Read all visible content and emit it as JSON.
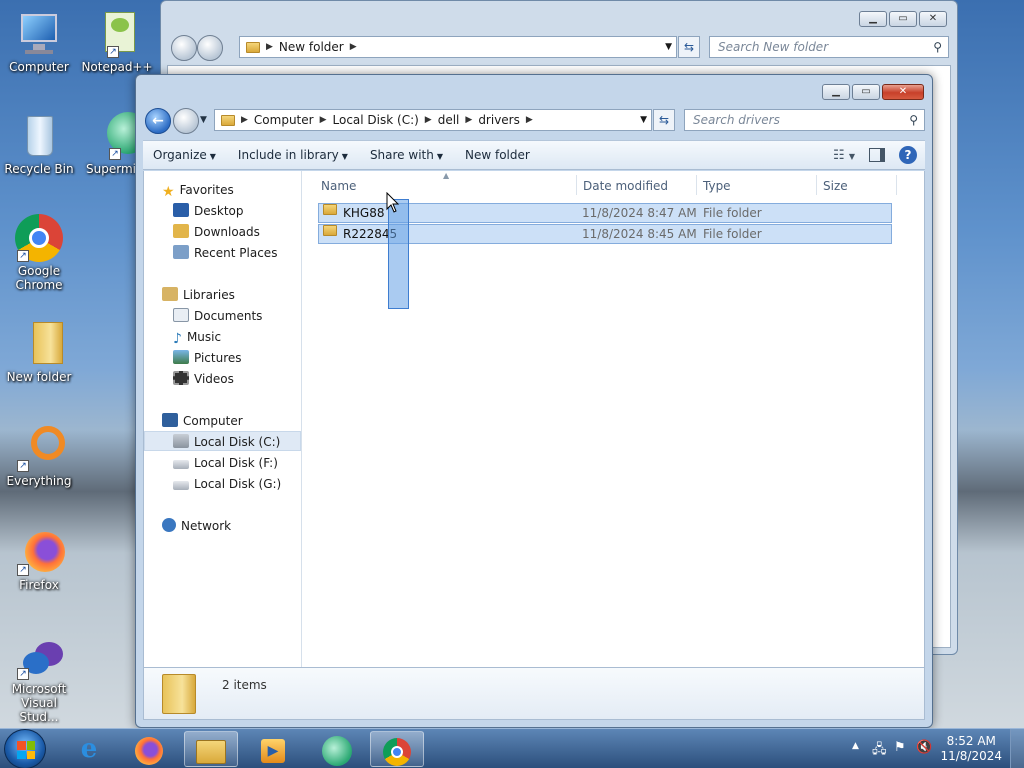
{
  "desktop": {
    "icons": [
      {
        "label": "Computer",
        "icon": "computer-icon"
      },
      {
        "label": "Notepad++",
        "icon": "notepad-plus-plus-icon"
      },
      {
        "label": "Recycle Bin",
        "icon": "recycle-bin-icon"
      },
      {
        "label": "Supermi",
        "icon": "supermium-icon"
      },
      {
        "label": "Google Chrome",
        "icon": "chrome-icon"
      },
      {
        "label": "New folder",
        "icon": "folder-icon"
      },
      {
        "label": "Everything",
        "icon": "everything-icon"
      },
      {
        "label": "Firefox",
        "icon": "firefox-icon"
      },
      {
        "label": "Microsoft Visual Stud...",
        "icon": "visual-studio-icon"
      }
    ]
  },
  "back_window": {
    "address": "New folder",
    "search_placeholder": "Search New folder"
  },
  "front_window": {
    "breadcrumb": [
      "Computer",
      "Local Disk (C:)",
      "dell",
      "drivers"
    ],
    "search_placeholder": "Search drivers",
    "toolbar": {
      "organize": "Organize",
      "include_in_library": "Include in library",
      "share_with": "Share with",
      "new_folder": "New folder"
    },
    "nav": {
      "favorites": "Favorites",
      "desktop": "Desktop",
      "downloads": "Downloads",
      "recent_places": "Recent Places",
      "libraries": "Libraries",
      "documents": "Documents",
      "music": "Music",
      "pictures": "Pictures",
      "videos": "Videos",
      "computer": "Computer",
      "local_disk_c": "Local Disk (C:)",
      "local_disk_f": "Local Disk (F:)",
      "local_disk_g": "Local Disk (G:)",
      "network": "Network"
    },
    "columns": {
      "name": "Name",
      "date_modified": "Date modified",
      "type": "Type",
      "size": "Size"
    },
    "files": [
      {
        "name": "KHG88",
        "date": "11/8/2024 8:47 AM",
        "type": "File folder"
      },
      {
        "name": "R222845",
        "date": "11/8/2024 8:45 AM",
        "type": "File folder"
      }
    ],
    "status": "2 items"
  },
  "taskbar": {
    "time": "8:52 AM",
    "date": "11/8/2024"
  },
  "colors": {
    "selection": "#cce0f7",
    "selection_border": "#84acdd",
    "marquee": "#3e7dd0"
  }
}
